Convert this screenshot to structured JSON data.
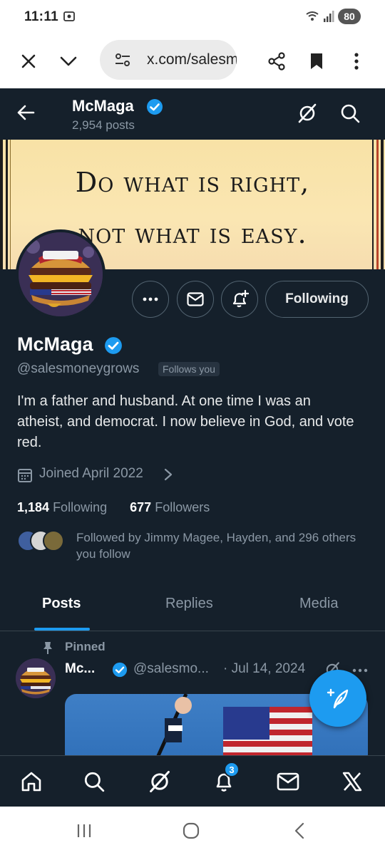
{
  "status_bar": {
    "time": "11:11",
    "battery": "80"
  },
  "browser": {
    "url": "x.com/salesmoneygrows"
  },
  "header": {
    "name": "McMaga",
    "posts_count": "2,954 posts"
  },
  "banner": {
    "line1": "Do what is right,",
    "line2": "not what is easy."
  },
  "profile": {
    "follow_button": "Following",
    "name": "McMaga",
    "handle": "@salesmoneygrows",
    "follows_you": "Follows you",
    "bio": "I'm a father and husband. At one time I was an atheist, and democrat. I now believe in God, and vote red.",
    "joined": "Joined April 2022",
    "following_count": "1,184",
    "following_label": "Following",
    "followers_count": "677",
    "followers_label": "Followers",
    "followed_by": "Followed by Jimmy Magee, Hayden, and 296 others you follow"
  },
  "tabs": [
    {
      "label": "Posts",
      "active": true
    },
    {
      "label": "Replies",
      "active": false
    },
    {
      "label": "Media",
      "active": false
    }
  ],
  "pinned_post": {
    "pinned_label": "Pinned",
    "author": "Mc...",
    "handle": "@salesmo...",
    "date": "· Jul 14, 2024"
  },
  "bottom_nav": {
    "notifications_badge": "3",
    "items": [
      "home-icon",
      "search-icon",
      "grok-icon",
      "notifications-icon",
      "messages-icon",
      "x-premium-icon"
    ]
  },
  "colors": {
    "x_background": "#15202b",
    "accent": "#1d9bf0",
    "muted_text": "#8b98a5"
  }
}
